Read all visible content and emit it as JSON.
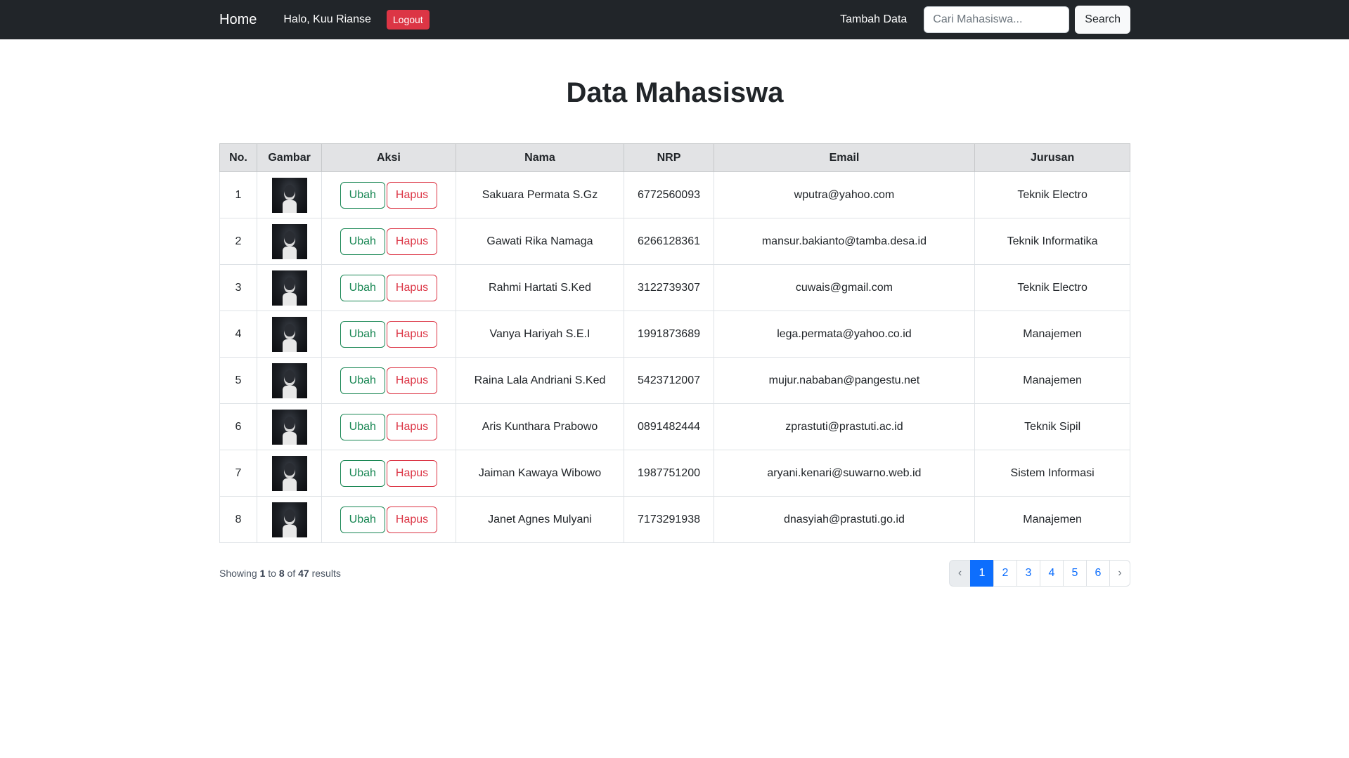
{
  "navbar": {
    "brand": "Home",
    "greeting": "Halo, Kuu Rianse",
    "logout_label": "Logout",
    "add_link": "Tambah Data",
    "search_placeholder": "Cari Mahasiswa...",
    "search_label": "Search"
  },
  "page": {
    "title": "Data Mahasiswa"
  },
  "table": {
    "headers": [
      "No.",
      "Gambar",
      "Aksi",
      "Nama",
      "NRP",
      "Email",
      "Jurusan"
    ],
    "edit_label": "Ubah",
    "delete_label": "Hapus",
    "rows": [
      {
        "no": "1",
        "nama": "Sakuara Permata S.Gz",
        "nrp": "6772560093",
        "email": "wputra@yahoo.com",
        "jurusan": "Teknik Electro"
      },
      {
        "no": "2",
        "nama": "Gawati Rika Namaga",
        "nrp": "6266128361",
        "email": "mansur.bakianto@tamba.desa.id",
        "jurusan": "Teknik Informatika"
      },
      {
        "no": "3",
        "nama": "Rahmi Hartati S.Ked",
        "nrp": "3122739307",
        "email": "cuwais@gmail.com",
        "jurusan": "Teknik Electro"
      },
      {
        "no": "4",
        "nama": "Vanya Hariyah S.E.I",
        "nrp": "1991873689",
        "email": "lega.permata@yahoo.co.id",
        "jurusan": "Manajemen"
      },
      {
        "no": "5",
        "nama": "Raina Lala Andriani S.Ked",
        "nrp": "5423712007",
        "email": "mujur.nababan@pangestu.net",
        "jurusan": "Manajemen"
      },
      {
        "no": "6",
        "nama": "Aris Kunthara Prabowo",
        "nrp": "0891482444",
        "email": "zprastuti@prastuti.ac.id",
        "jurusan": "Teknik Sipil"
      },
      {
        "no": "7",
        "nama": "Jaiman Kawaya Wibowo",
        "nrp": "1987751200",
        "email": "aryani.kenari@suwarno.web.id",
        "jurusan": "Sistem Informasi"
      },
      {
        "no": "8",
        "nama": "Janet Agnes Mulyani",
        "nrp": "7173291938",
        "email": "dnasyiah@prastuti.go.id",
        "jurusan": "Manajemen"
      }
    ]
  },
  "pagination_info": {
    "prefix": "Showing",
    "from": "1",
    "to_word": "to",
    "to": "8",
    "of_word": "of",
    "total": "47",
    "suffix": "results"
  },
  "pagination": {
    "prev": "‹",
    "next": "›",
    "pages": [
      "1",
      "2",
      "3",
      "4",
      "5",
      "6"
    ],
    "active": "1"
  }
}
